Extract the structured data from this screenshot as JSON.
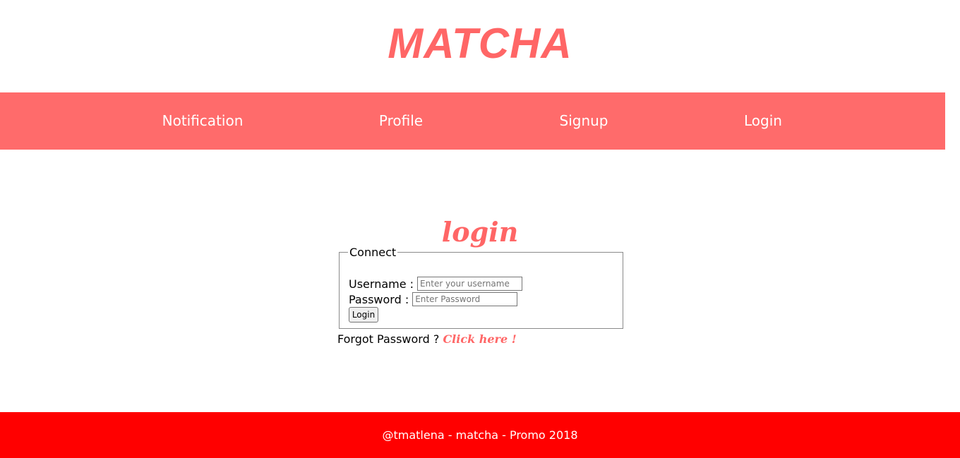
{
  "brand": {
    "title": "MATCHA"
  },
  "nav": {
    "items": [
      {
        "label": "Notification"
      },
      {
        "label": "Profile"
      },
      {
        "label": "Signup"
      },
      {
        "label": "Login"
      }
    ]
  },
  "main": {
    "title": "login",
    "form": {
      "legend": "Connect",
      "username_label": "Username :",
      "username_placeholder": "Enter your username",
      "password_label": "Password :",
      "password_placeholder": "Enter Password",
      "submit_label": "Login"
    },
    "forgot": {
      "text": "Forgot Password ?",
      "link_label": "Click here !"
    }
  },
  "footer": {
    "text": "@tmatlena - matcha - Promo 2018"
  },
  "colors": {
    "accent": "#ff6666",
    "navbar": "#ff6b6b",
    "footer": "#ff0000"
  }
}
